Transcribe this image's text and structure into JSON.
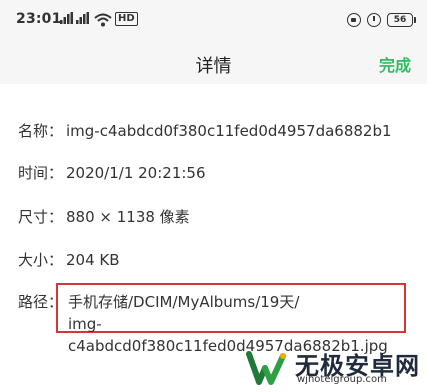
{
  "status_bar": {
    "time": "23:01",
    "signal_1": "▐▐",
    "signal_2": "▐▐",
    "network": "HD",
    "battery": "56"
  },
  "header": {
    "title": "详情",
    "done_label": "完成",
    "done_color": "#2dbe60"
  },
  "details": {
    "name_label": "名称：",
    "name_value": "img-c4abdcd0f380c11fed0d4957da6882b1",
    "time_label": "时间：",
    "time_value": "2020/1/1 20:21:56",
    "size_label": "尺寸：",
    "size_value": "880 × 1138 像素",
    "filesize_label": "大小：",
    "filesize_value": "204 KB",
    "path_label": "路径：",
    "path_line1": "手机存储/DCIM/MyAlbums/19天/",
    "path_line2": "img-c4abdcd0f380c11fed0d4957da6882b1.jpg",
    "highlight_color": "#d7343a"
  },
  "watermark": {
    "name": "无极安卓网",
    "url": "wjhotelgroup.com"
  }
}
